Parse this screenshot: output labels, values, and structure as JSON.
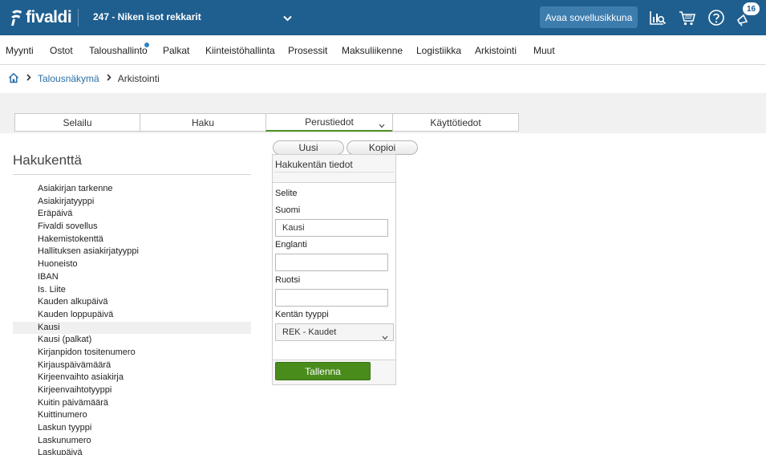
{
  "header": {
    "logo_text": "fivaldi",
    "company": "247 - Niken isot rekkarit",
    "open_app_button": "Avaa sovellusikkuna",
    "notification_count": "16",
    "icons": [
      "reports-search-icon",
      "cart-icon",
      "help-icon",
      "notifications-icon"
    ],
    "colors": {
      "topbar": "#1f5f8f",
      "accent_green": "#4a8c1c",
      "link": "#2a6fa8"
    }
  },
  "mainnav": {
    "items": [
      "Myynti",
      "Ostot",
      "Taloushallinto",
      "Palkat",
      "Kiinteistöhallinta",
      "Prosessit",
      "Maksuliikenne",
      "Logistiikka",
      "Arkistointi",
      "Muut"
    ]
  },
  "breadcrumb": {
    "home_icon": "home-icon",
    "link": "Talousnäkymä",
    "current": "Arkistointi"
  },
  "subtabs": {
    "items": [
      "Selailu",
      "Haku",
      "Perustiedot",
      "Käyttötiedot"
    ],
    "active": "Perustiedot"
  },
  "left": {
    "title": "Hakukenttä",
    "selected": "Kausi",
    "fields": [
      "Asiakirjan tarkenne",
      "Asiakirjatyyppi",
      "Eräpäivä",
      "Fivaldi sovellus",
      "Hakemistokenttä",
      "Hallituksen asiakirjatyyppi",
      "Huoneisto",
      "IBAN",
      "Is. Liite",
      "Kauden alkupäivä",
      "Kauden loppupäivä",
      "Kausi",
      "Kausi (palkat)",
      "Kirjanpidon tositenumero",
      "Kirjauspäivämäärä",
      "Kirjeenvaihto asiakirja",
      "Kirjeenvaihtotyyppi",
      "Kuitin päivämäärä",
      "Kuittinumero",
      "Laskun tyyppi",
      "Laskunumero",
      "Laskupäivä"
    ]
  },
  "actions": {
    "new_button": "Uusi",
    "copy_button": "Kopioi"
  },
  "detail": {
    "title": "Hakukentän tiedot",
    "section_label": "Selite",
    "finnish_label": "Suomi",
    "finnish_value": "Kausi",
    "english_label": "Englanti",
    "english_value": "",
    "swedish_label": "Ruotsi",
    "swedish_value": "",
    "type_label": "Kentän tyyppi",
    "type_value": "REK - Kaudet",
    "save_button": "Tallenna"
  }
}
